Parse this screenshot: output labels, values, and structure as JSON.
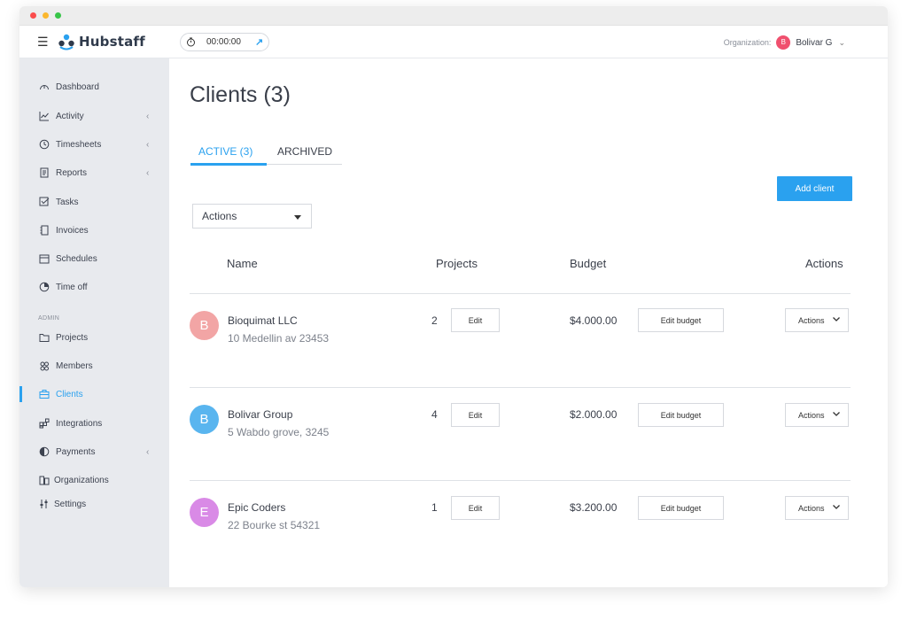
{
  "app": {
    "name": "Hubstaff",
    "timer": "00:00:00",
    "organization_label": "Organization:",
    "organization_avatar": "B",
    "organization_name": "Bolivar G",
    "accent_color": "#2aa1ef"
  },
  "sidebar": {
    "items": [
      {
        "label": "Dashboard",
        "icon": "dashboard-icon",
        "has_chevron": false
      },
      {
        "label": "Activity",
        "icon": "chart-icon",
        "has_chevron": true
      },
      {
        "label": "Timesheets",
        "icon": "clock-icon",
        "has_chevron": true
      },
      {
        "label": "Reports",
        "icon": "document-icon",
        "has_chevron": true
      },
      {
        "label": "Tasks",
        "icon": "checkbox-icon",
        "has_chevron": false
      },
      {
        "label": "Invoices",
        "icon": "invoice-icon",
        "has_chevron": false
      },
      {
        "label": "Schedules",
        "icon": "calendar-icon",
        "has_chevron": false
      },
      {
        "label": "Time off",
        "icon": "pie-icon",
        "has_chevron": false
      }
    ],
    "admin_label": "ADMIN",
    "admin_items": [
      {
        "label": "Projects",
        "icon": "folder-icon",
        "has_chevron": false
      },
      {
        "label": "Members",
        "icon": "members-icon",
        "has_chevron": false
      },
      {
        "label": "Clients",
        "icon": "briefcase-icon",
        "has_chevron": false,
        "active": true
      },
      {
        "label": "Integrations",
        "icon": "integrations-icon",
        "has_chevron": false
      },
      {
        "label": "Payments",
        "icon": "payments-icon",
        "has_chevron": true
      },
      {
        "label": "Organizations",
        "icon": "organizations-icon",
        "has_chevron": false
      },
      {
        "label": "Settings",
        "icon": "sliders-icon",
        "has_chevron": false
      }
    ]
  },
  "main": {
    "title": "Clients (3)",
    "tabs": [
      {
        "label": "ACTIVE (3)",
        "active": true
      },
      {
        "label": "ARCHIVED",
        "active": false
      }
    ],
    "add_client_label": "Add client",
    "actions_select": "Actions",
    "table": {
      "headers": {
        "name": "Name",
        "projects": "Projects",
        "budget": "Budget",
        "actions": "Actions"
      },
      "edit_label": "Edit",
      "edit_budget_label": "Edit budget",
      "row_actions_label": "Actions",
      "rows": [
        {
          "initial": "B",
          "name": "Bioquimat LLC",
          "address": "10 Medellin av 23453",
          "projects": "2",
          "budget": "$4.000.00",
          "color": "#f2a5a5"
        },
        {
          "initial": "B",
          "name": "Bolivar Group",
          "address": "5 Wabdo grove, 3245",
          "projects": "4",
          "budget": "$2.000.00",
          "color": "#59b5ef"
        },
        {
          "initial": "E",
          "name": "Epic Coders",
          "address": "22 Bourke st 54321",
          "projects": "1",
          "budget": "$3.200.00",
          "color": "#d98ae6"
        }
      ]
    }
  }
}
